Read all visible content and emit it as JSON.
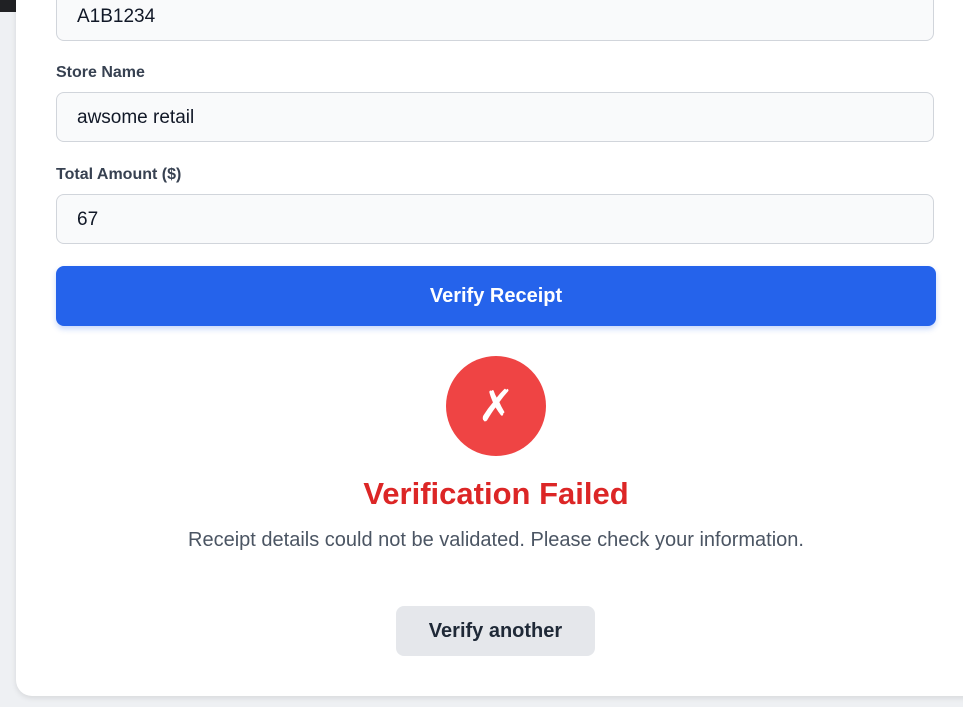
{
  "form": {
    "receipt_number_value": "A1B1234",
    "store_name_label": "Store Name",
    "store_name_value": "awsome retail",
    "total_amount_label": "Total Amount ($)",
    "total_amount_value": "67",
    "verify_button_label": "Verify Receipt"
  },
  "result": {
    "status_icon": "✗",
    "icon_name": "x-mark-icon",
    "title": "Verification Failed",
    "message": "Receipt details could not be validated. Please check your information.",
    "verify_another_label": "Verify another",
    "colors": {
      "error": "#dc2626",
      "icon_bg": "#ef4444",
      "primary": "#2563eb"
    }
  }
}
